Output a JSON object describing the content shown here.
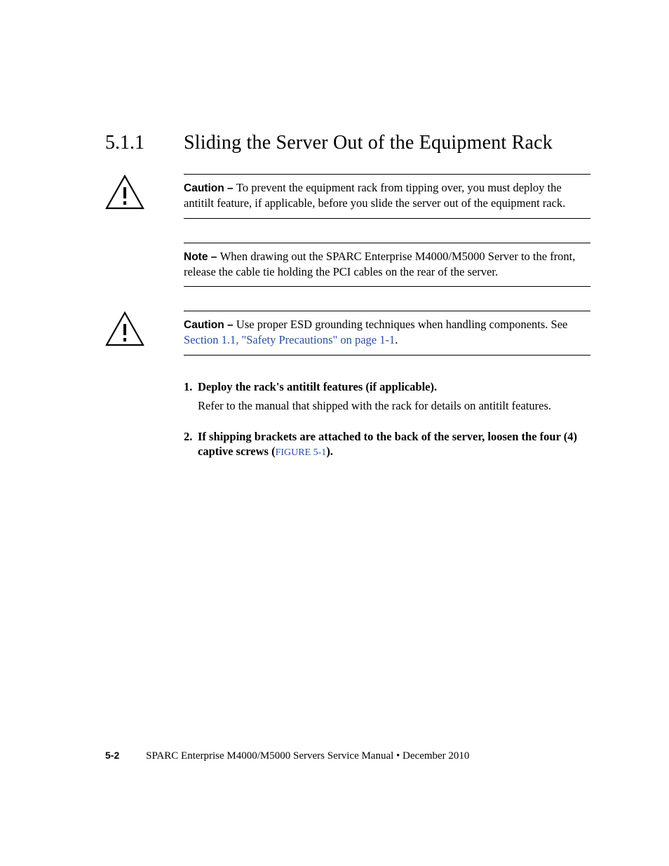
{
  "heading": {
    "number": "5.1.1",
    "title": "Sliding the Server Out of the Equipment Rack"
  },
  "caution1": {
    "label": "Caution – ",
    "text": "To prevent the equipment rack from tipping over, you must deploy the antitilt feature, if applicable, before you slide the server out of the equipment rack."
  },
  "note1": {
    "label": "Note – ",
    "text": "When drawing out the SPARC Enterprise M4000/M5000 Server to the front, release the cable tie holding the PCI cables on the rear of the server."
  },
  "caution2": {
    "label": "Caution – ",
    "text_before": "Use proper ESD grounding techniques when handling components. See ",
    "link": "Section 1.1, \"Safety Precautions\" on page 1-1",
    "text_after": "."
  },
  "steps": [
    {
      "num": "1.",
      "title": "Deploy the rack's antitilt features (if applicable).",
      "sub": "Refer to the manual that shipped with the rack for details on antitilt features."
    },
    {
      "num": "2.",
      "title_before": "If shipping brackets are attached to the back of the server, loosen the four (4) captive screws (",
      "xref": "FIGURE 5-1",
      "title_after": ")."
    }
  ],
  "footer": {
    "page": "5-2",
    "title": "SPARC Enterprise M4000/M5000 Servers Service Manual  •  December 2010"
  }
}
